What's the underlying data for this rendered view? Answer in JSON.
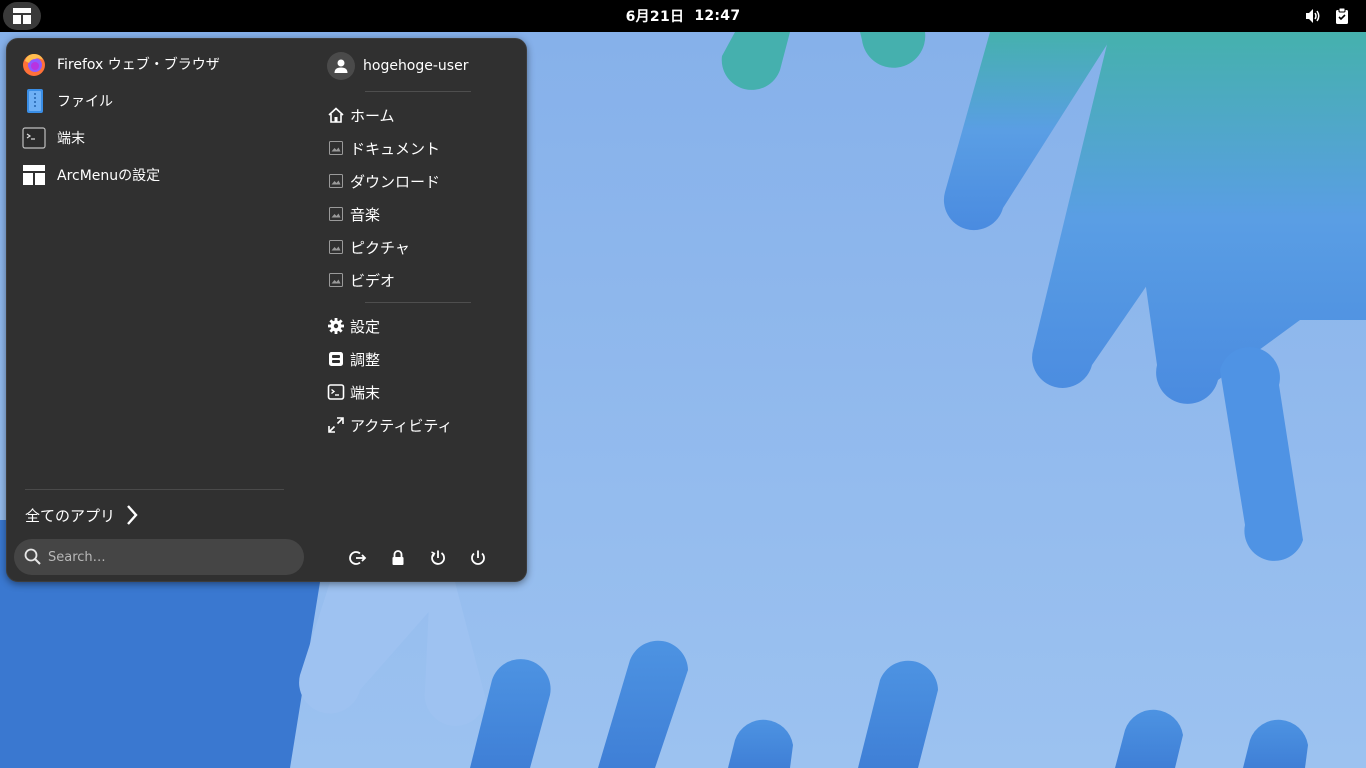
{
  "topbar": {
    "clock_date": "6月21日",
    "clock_time": "12:47",
    "icons": [
      "activities-icon",
      "volume-icon",
      "clipboard-icon"
    ]
  },
  "menu": {
    "apps": [
      {
        "label": "Firefox ウェブ・ブラウザ",
        "icon": "firefox-icon"
      },
      {
        "label": "ファイル",
        "icon": "files-icon"
      },
      {
        "label": "端末",
        "icon": "terminal-icon"
      },
      {
        "label": "ArcMenuの設定",
        "icon": "arcmenu-icon"
      }
    ],
    "all_apps_label": "全てのアプリ",
    "search_placeholder": "Search…",
    "user": {
      "name": "hogehoge-user"
    },
    "places": [
      {
        "label": "ホーム",
        "icon": "home-icon"
      },
      {
        "label": "ドキュメント",
        "icon": "folder-icon"
      },
      {
        "label": "ダウンロード",
        "icon": "folder-icon"
      },
      {
        "label": "音楽",
        "icon": "folder-icon"
      },
      {
        "label": "ピクチャ",
        "icon": "folder-icon"
      },
      {
        "label": "ビデオ",
        "icon": "folder-icon"
      }
    ],
    "shortcuts": [
      {
        "label": "設定",
        "icon": "gear-icon"
      },
      {
        "label": "調整",
        "icon": "tweaks-icon"
      },
      {
        "label": "端末",
        "icon": "terminal-icon"
      },
      {
        "label": "アクティビティ",
        "icon": "activities-expand-icon"
      }
    ],
    "session_buttons": [
      "logout-icon",
      "lock-icon",
      "restart-icon",
      "power-icon"
    ]
  },
  "colors": {
    "panel": "#303030",
    "topbar": "#000000",
    "wallpaper_light": "#8fb6ec",
    "wallpaper_dark": "#3f7fd6",
    "wallpaper_teal": "#46b3b0"
  }
}
